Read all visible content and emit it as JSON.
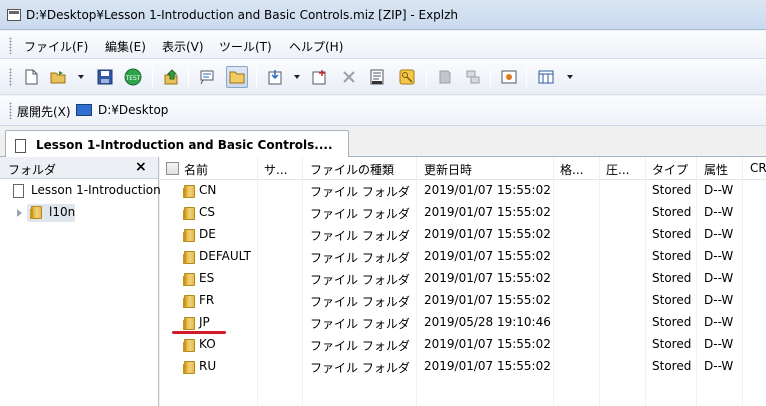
{
  "window": {
    "title": "D:¥Desktop¥Lesson 1-Introduction and Basic Controls.miz [ZIP] - Explzh"
  },
  "menu": [
    "ファイル(F)",
    "編集(E)",
    "表示(V)",
    "ツール(T)",
    "ヘルプ(H)"
  ],
  "address": {
    "label": "展開先(X)",
    "value": "D:¥Desktop"
  },
  "tab": {
    "label": "Lesson 1-Introduction and Basic Controls...."
  },
  "folder_pane": {
    "title": "フォルダ",
    "close_glyph": "×",
    "root": "Lesson 1-Introduction",
    "child": "l10n"
  },
  "columns": [
    "名前",
    "サ...",
    "ファイルの種類",
    "更新日時",
    "格...",
    "圧...",
    "タイプ",
    "属性",
    "CR"
  ],
  "rows": [
    {
      "name": "CN",
      "kind": "ファイル フォルダ",
      "date": "2019/01/07 15:55:02",
      "type": "Stored",
      "attr": "D--W"
    },
    {
      "name": "CS",
      "kind": "ファイル フォルダ",
      "date": "2019/01/07 15:55:02",
      "type": "Stored",
      "attr": "D--W"
    },
    {
      "name": "DE",
      "kind": "ファイル フォルダ",
      "date": "2019/01/07 15:55:02",
      "type": "Stored",
      "attr": "D--W"
    },
    {
      "name": "DEFAULT",
      "kind": "ファイル フォルダ",
      "date": "2019/01/07 15:55:02",
      "type": "Stored",
      "attr": "D--W"
    },
    {
      "name": "ES",
      "kind": "ファイル フォルダ",
      "date": "2019/01/07 15:55:02",
      "type": "Stored",
      "attr": "D--W"
    },
    {
      "name": "FR",
      "kind": "ファイル フォルダ",
      "date": "2019/01/07 15:55:02",
      "type": "Stored",
      "attr": "D--W"
    },
    {
      "name": "JP",
      "kind": "ファイル フォルダ",
      "date": "2019/05/28 19:10:46",
      "type": "Stored",
      "attr": "D--W"
    },
    {
      "name": "KO",
      "kind": "ファイル フォルダ",
      "date": "2019/01/07 15:55:02",
      "type": "Stored",
      "attr": "D--W"
    },
    {
      "name": "RU",
      "kind": "ファイル フォルダ",
      "date": "2019/01/07 15:55:02",
      "type": "Stored",
      "attr": "D--W"
    }
  ],
  "colors": {
    "highlight_underline": "#d21a2b",
    "folder": "#e6b94a",
    "titlebar": "#c9d9ee"
  },
  "toolbar_icons": [
    "new-archive-icon",
    "open-archive-icon",
    "save-icon",
    "test-icon",
    "up-folder-icon",
    "view-icon",
    "folder-view-icon",
    "extract-icon",
    "add-file-icon",
    "delete-icon",
    "properties-icon",
    "key-icon",
    "attach-icon",
    "convert-icon",
    "install-icon",
    "view-mode-icon"
  ]
}
